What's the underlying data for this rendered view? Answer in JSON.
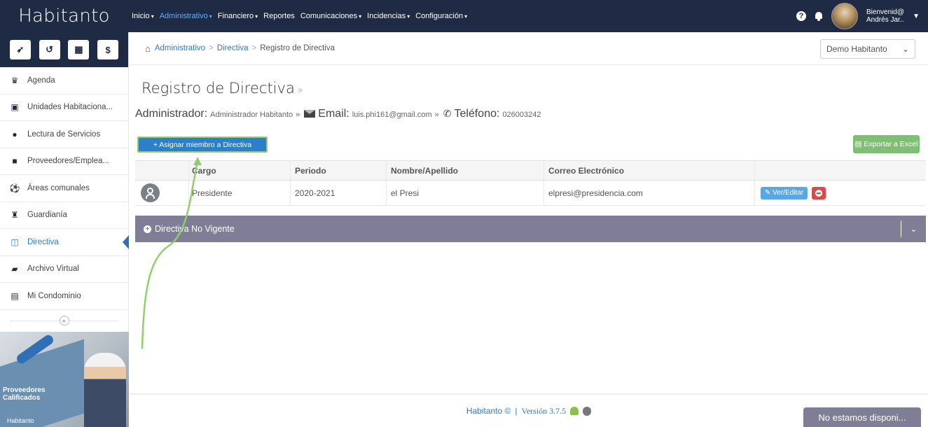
{
  "app": {
    "brand": "Habitanto"
  },
  "nav": {
    "items": [
      {
        "label": "Inicio",
        "caret": "▾",
        "active": false
      },
      {
        "label": "Administrativo",
        "caret": "▾",
        "active": true
      },
      {
        "label": "Financiero",
        "caret": "▾",
        "active": false
      },
      {
        "label": "Reportes",
        "caret": "",
        "active": false
      },
      {
        "label": "Comunicaciones",
        "caret": "▾",
        "active": false
      },
      {
        "label": "Incidencias",
        "caret": "▾",
        "active": false
      },
      {
        "label": "Configuración",
        "caret": "▾",
        "active": false
      }
    ],
    "help": "?",
    "user": {
      "greeting": "Bienvenid@",
      "name": "Andrés Jar..",
      "caret": "▼"
    }
  },
  "sidebar": {
    "tools": [
      {
        "icon": "send-icon",
        "glyph": "➶"
      },
      {
        "icon": "history-icon",
        "glyph": "↺"
      },
      {
        "icon": "calculator-icon",
        "glyph": "▦"
      },
      {
        "icon": "dollar-icon",
        "glyph": "$"
      }
    ],
    "items": [
      {
        "label": "Agenda",
        "icon": "agenda-icon",
        "glyph": "♛"
      },
      {
        "label": "Unidades Habitaciona...",
        "icon": "building-unit-icon",
        "glyph": "▣"
      },
      {
        "label": "Lectura de Servicios",
        "icon": "drop-icon",
        "glyph": "●"
      },
      {
        "label": "Proveedores/Emplea...",
        "icon": "truck-icon",
        "glyph": "■"
      },
      {
        "label": "Áreas comunales",
        "icon": "soccer-ball-icon",
        "glyph": "⚽"
      },
      {
        "label": "Guardianía",
        "icon": "guard-icon",
        "glyph": "♜"
      },
      {
        "label": "Directiva",
        "icon": "columns-icon",
        "glyph": "◫"
      },
      {
        "label": "Archivo Virtual",
        "icon": "book-icon",
        "glyph": "▰"
      },
      {
        "label": "Mi Condominio",
        "icon": "building-icon",
        "glyph": "▤"
      }
    ],
    "active_index": 6,
    "collapse": "«",
    "promo": {
      "title_line1": "Proveedores",
      "title_line2": "Calificados",
      "brand": "Habitanto"
    }
  },
  "breadcrumb": {
    "items": [
      "Administrativo",
      "Directiva"
    ],
    "current": "Registro de Directiva",
    "separator": ">"
  },
  "project_select": {
    "value": "Demo Habitanto",
    "caret": "⌄"
  },
  "page": {
    "title": "Registro de Directiva",
    "title_suffix": "»",
    "admin_label": "Administrador:",
    "admin_value": "Administrador Habitanto",
    "sep": "»",
    "email_label": "Email:",
    "email_value": "luis.phi161@gmail.com",
    "phone_label": "Teléfono:",
    "phone_value": "026003242"
  },
  "actions": {
    "assign": "+ Asignar miembro a Directiva",
    "export": "Exportar a Excel"
  },
  "table": {
    "columns": [
      "",
      "Cargo",
      "Periodo",
      "Nombre/Apellido",
      "Correo Electrónico",
      ""
    ],
    "rows": [
      {
        "cargo": "Presidente",
        "periodo": "2020-2021",
        "nombre": "el Presi",
        "correo": "elpresi@presidencia.com",
        "edit": "Ver/Editar"
      }
    ]
  },
  "collapse_panel": {
    "label": "Directiva No Vigente",
    "plus": "+",
    "chevron": "⌄"
  },
  "footer": {
    "brand": "Habitanto ©",
    "sep": "|",
    "version": "Versión 3.7.5"
  },
  "chat": {
    "label": "No estamos disponi..."
  }
}
